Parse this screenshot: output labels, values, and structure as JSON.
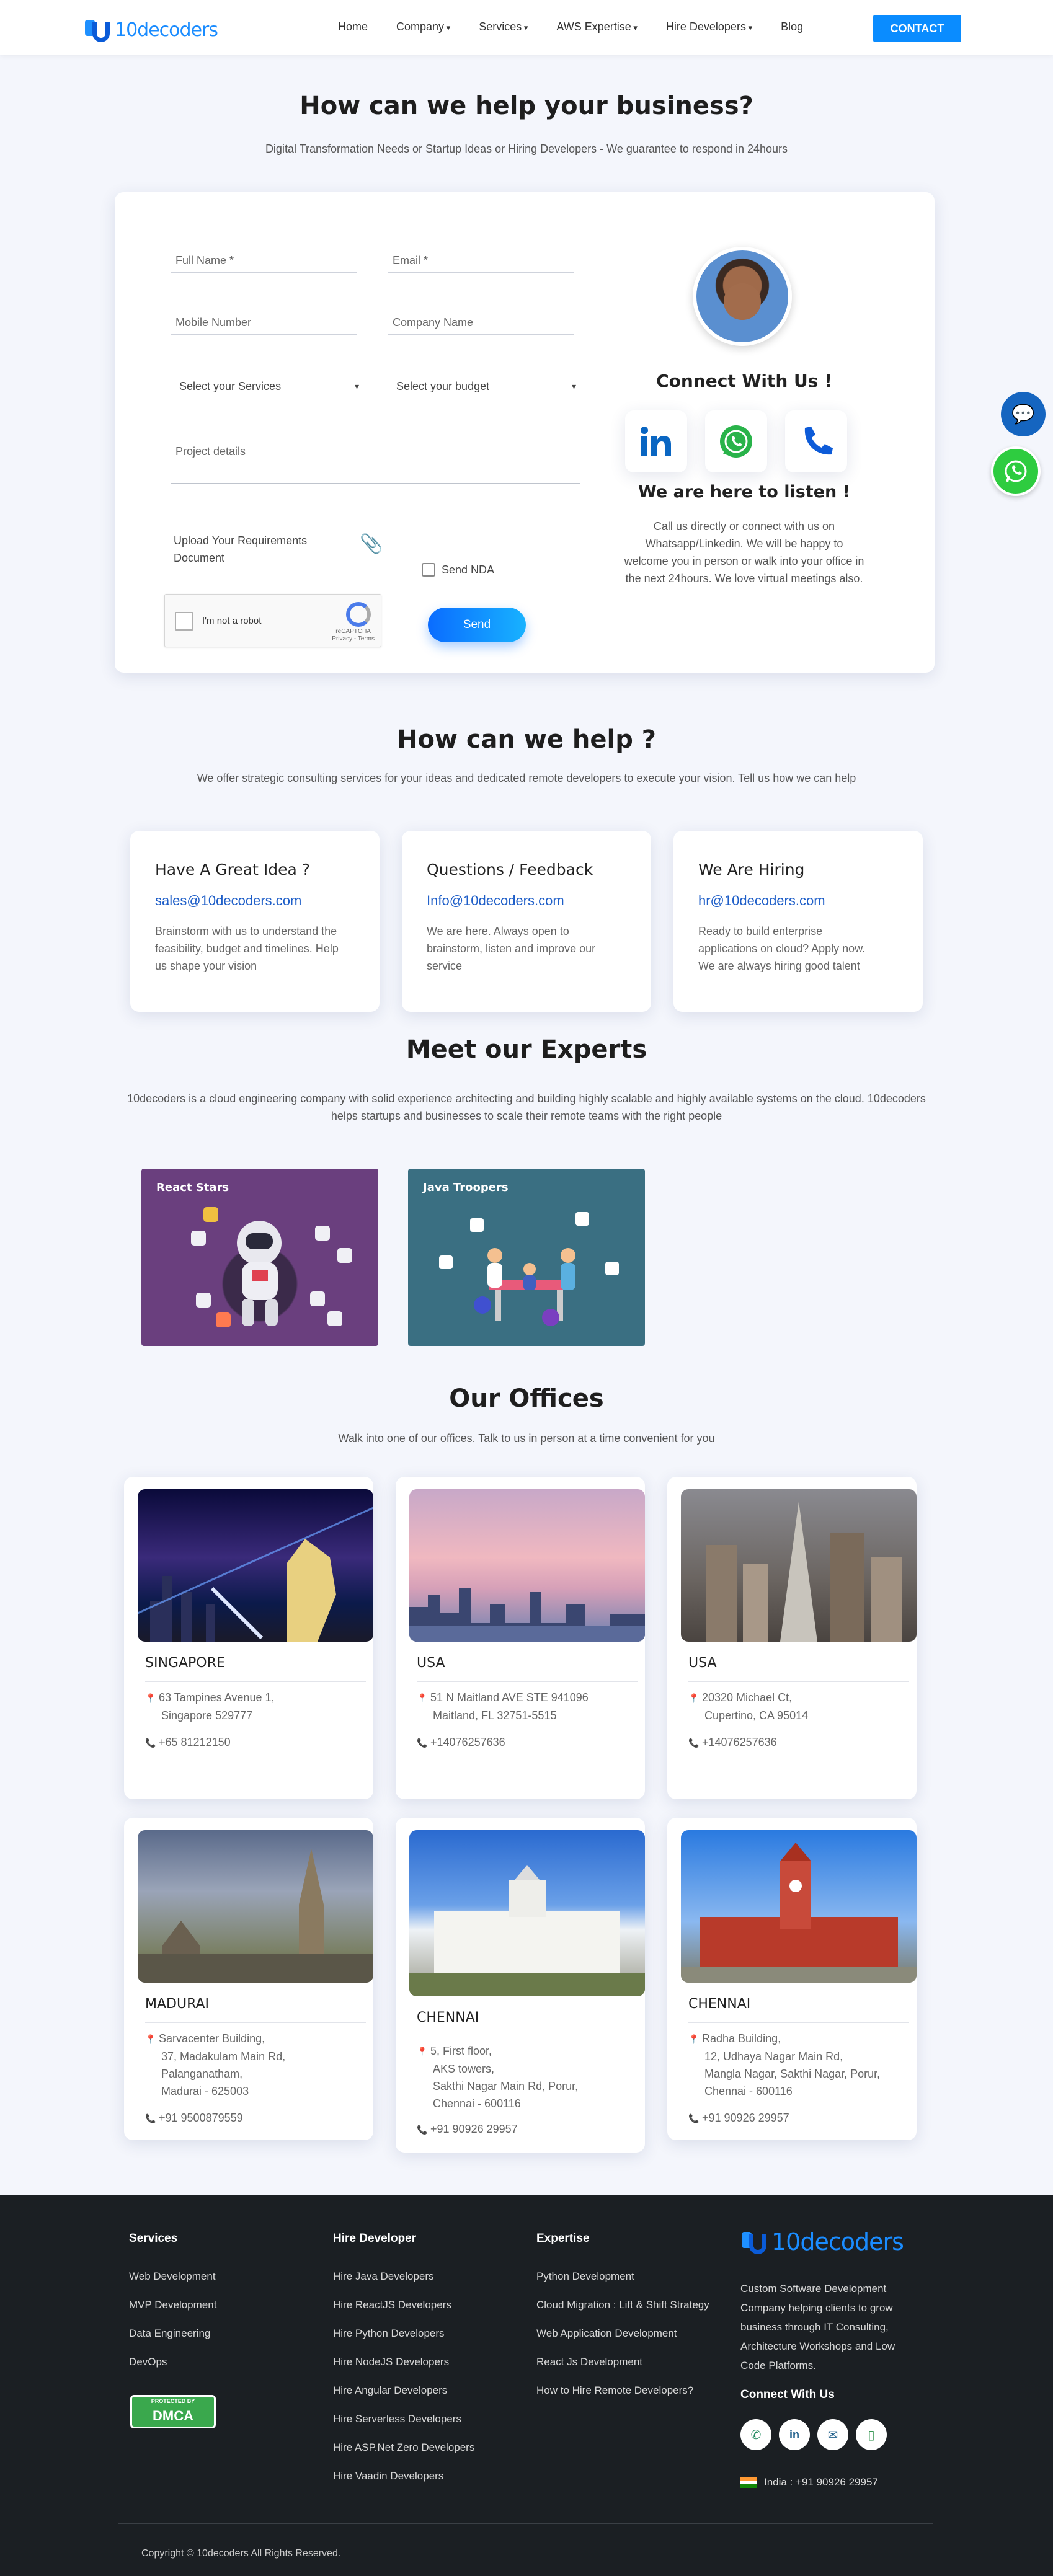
{
  "nav": {
    "logo_text": "10decoders",
    "items": [
      "Home",
      "Company",
      "Services",
      "AWS Expertise",
      "Hire Developers",
      "Blog"
    ],
    "contact_label": "CONTACT"
  },
  "hero": {
    "title": "How can we help your business?",
    "subtitle": "Digital Transformation Needs or Startup Ideas or Hiring Developers - We guarantee to respond in 24hours"
  },
  "form": {
    "full_name_placeholder": "Full Name *",
    "email_placeholder": "Email *",
    "mobile_placeholder": "Mobile Number",
    "company_placeholder": "Company Name",
    "services_select": "Select your Services",
    "budget_select": "Select your budget",
    "project_placeholder": "Project details",
    "upload_label": "Upload Your Requirements Document",
    "nda_label": "Send NDA",
    "captcha_label": "I'm not a robot",
    "captcha_brand": "reCAPTCHA",
    "captcha_terms": "Privacy - Terms",
    "send_label": "Send"
  },
  "connect": {
    "title": "Connect With Us !",
    "listen_title": "We are here to listen !",
    "listen_text": "Call us directly or connect with us on Whatsapp/Linkedin. We will be happy to welcome you in person or walk into your office in the next 24hours. We love virtual meetings also."
  },
  "help": {
    "title": "How can we help ?",
    "subtitle": "We offer strategic consulting services for your ideas and dedicated remote developers to execute your vision. Tell us how we can help",
    "cards": [
      {
        "title": "Have A Great Idea ?",
        "email": "sales@10decoders.com",
        "text": "Brainstorm with us to understand the feasibility, budget and timelines. Help us shape your vision"
      },
      {
        "title": "Questions / Feedback",
        "email": "Info@10decoders.com",
        "text": "We are here. Always open to brainstorm, listen and improve our service"
      },
      {
        "title": "We Are Hiring",
        "email": "hr@10decoders.com",
        "text": "Ready to build enterprise applications on cloud? Apply now. We are always hiring good talent"
      }
    ]
  },
  "experts": {
    "title": "Meet our Experts",
    "text": "10decoders is a cloud engineering company with solid experience architecting and building highly scalable and highly available systems on the cloud. 10decoders helps startups and businesses to scale their remote teams with the right people",
    "cards": [
      {
        "label": "React Stars"
      },
      {
        "label": "Java Troopers"
      }
    ]
  },
  "offices": {
    "title": "Our Offices",
    "subtitle": "Walk into one of our offices. Talk to us in person at a time convenient for you",
    "list": [
      {
        "name": "SINGAPORE",
        "addr": [
          "63 Tampines Avenue 1,",
          "Singapore 529777"
        ],
        "phone": "+65 81212150"
      },
      {
        "name": "USA",
        "addr": [
          "51 N Maitland AVE STE 941096",
          "Maitland, FL 32751-5515"
        ],
        "phone": "+14076257636"
      },
      {
        "name": "USA",
        "addr": [
          "20320 Michael Ct,",
          "Cupertino, CA 95014"
        ],
        "phone": "+14076257636"
      },
      {
        "name": "MADURAI",
        "addr": [
          "Sarvacenter Building,",
          "37, Madakulam Main Rd,",
          "Palanganatham,",
          "Madurai - 625003"
        ],
        "phone": "+91 9500879559"
      },
      {
        "name": "CHENNAI",
        "addr": [
          "5, First floor,",
          "AKS towers,",
          "Sakthi Nagar Main Rd, Porur,",
          "Chennai - 600116"
        ],
        "phone": "+91 90926 29957"
      },
      {
        "name": "CHENNAI",
        "addr": [
          "Radha Building,",
          "12, Udhaya Nagar Main Rd,",
          "Mangla Nagar, Sakthi Nagar, Porur,",
          "Chennai - 600116"
        ],
        "phone": "+91 90926 29957"
      }
    ]
  },
  "footer": {
    "services_title": "Services",
    "services": [
      "Web Development",
      "MVP Development",
      "Data Engineering",
      "DevOps"
    ],
    "hire_title": "Hire Developer",
    "hire": [
      "Hire Java Developers",
      "Hire ReactJS Developers",
      "Hire Python Developers",
      "Hire NodeJS Developers",
      "Hire Angular Developers",
      "Hire Serverless Developers",
      "Hire ASP.Net Zero Developers",
      "Hire Vaadin Developers"
    ],
    "expertise_title": "Expertise",
    "expertise": [
      "Python Development",
      "Cloud Migration : Lift & Shift Strategy",
      "Web Application Development",
      "React Js Development",
      "How to Hire Remote Developers?"
    ],
    "logo_text": "10decoders",
    "description": "Custom Software Development Company helping clients to grow business through IT Consulting, Architecture Workshops and Low Code Platforms.",
    "connect_title": "Connect With Us",
    "phone": "India : +91 90926 29957",
    "dmca_top": "PROTECTED BY",
    "dmca_text": "DMCA",
    "copyright": "Copyright © 10decoders All Rights Reserved."
  },
  "colors": {
    "accent": "#0a8cff",
    "link": "#1e5ec8",
    "footer_bg": "#1b1f23"
  }
}
